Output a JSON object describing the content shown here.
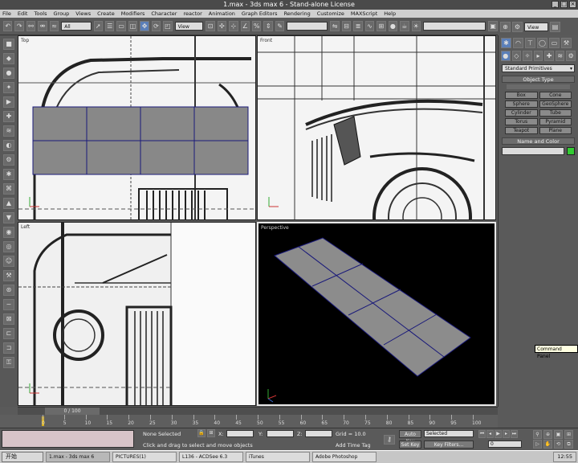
{
  "window": {
    "title": "1.max - 3ds max 6 - Stand-alone License"
  },
  "menu": [
    "File",
    "Edit",
    "Tools",
    "Group",
    "Views",
    "Create",
    "Modifiers",
    "Character",
    "reactor",
    "Animation",
    "Graph Editors",
    "Rendering",
    "Customize",
    "MAXScript",
    "Help"
  ],
  "toolbar": {
    "selection_filter": "All",
    "ref_coord": "View"
  },
  "viewports": {
    "top": "Top",
    "front": "Front",
    "left": "Left",
    "perspective": "Perspective"
  },
  "command_panel": {
    "category": "Standard Primitives",
    "object_type_header": "Object Type",
    "buttons": [
      "Box",
      "Cone",
      "Sphere",
      "GeoSphere",
      "Cylinder",
      "Tube",
      "Torus",
      "Pyramid",
      "Teapot",
      "Plane"
    ],
    "name_color_header": "Name and Color",
    "name_value": "",
    "color": "#33cc33"
  },
  "tooltip": "Command Panel",
  "time_slider": {
    "label": "0 / 100"
  },
  "timeline": {
    "ticks": [
      "0",
      "5",
      "10",
      "15",
      "20",
      "25",
      "30",
      "35",
      "40",
      "45",
      "50",
      "55",
      "60",
      "65",
      "70",
      "75",
      "80",
      "85",
      "90",
      "95",
      "100"
    ]
  },
  "status": {
    "selection": "None Selected",
    "prompt": "Click and drag to select and move objects",
    "x_label": "X:",
    "y_label": "Y:",
    "z_label": "Z:",
    "grid": "Grid = 10.0",
    "add_time_tag": "Add Time Tag",
    "auto_key": "Auto Key",
    "key_mode": "Selected",
    "set_key": "Set Key",
    "key_filters": "Key Filters...",
    "frame": "0"
  },
  "taskbar": {
    "start": "开始",
    "tasks": [
      "1.max - 3ds max 6",
      "PICTURES(1)",
      "L136 - ACDSee 6.3",
      "iTunes",
      "Adobe Photoshop"
    ],
    "clock": "12:55"
  }
}
